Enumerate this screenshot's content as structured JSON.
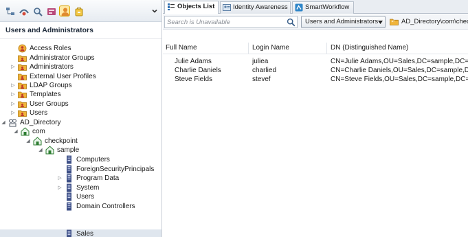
{
  "toolbar": {
    "buttons": [
      {
        "icon": "network-objects-icon"
      },
      {
        "icon": "services-icon"
      },
      {
        "icon": "custom-application-icon"
      },
      {
        "icon": "vpn-communities-icon"
      },
      {
        "icon": "users-icon",
        "active": true
      },
      {
        "icon": "servers-icon"
      }
    ],
    "menu_icon": "chevron-down-icon"
  },
  "panel": {
    "title": "Users and Administrators"
  },
  "tree": [
    {
      "label": "Access Roles",
      "icon": "role-icon",
      "expander": ""
    },
    {
      "label": "Administrator Groups",
      "icon": "group-icon",
      "expander": ""
    },
    {
      "label": "Administrators",
      "icon": "group-icon",
      "expander": "▷"
    },
    {
      "label": "External User Profiles",
      "icon": "group-icon",
      "expander": ""
    },
    {
      "label": "LDAP Groups",
      "icon": "group-icon",
      "expander": "▷"
    },
    {
      "label": "Templates",
      "icon": "group-icon",
      "expander": "▷"
    },
    {
      "label": "User Groups",
      "icon": "group-icon",
      "expander": "▷"
    },
    {
      "label": "Users",
      "icon": "group-icon",
      "expander": "▷"
    },
    {
      "label": "AD_Directory",
      "icon": "directory-icon",
      "expander": "◢"
    },
    {
      "label": "com",
      "icon": "domain-icon",
      "expander": "◢"
    },
    {
      "label": "checkpoint",
      "icon": "domain-icon",
      "expander": "◢"
    },
    {
      "label": "sample",
      "icon": "domain-icon",
      "expander": "◢"
    },
    {
      "label": "Computers",
      "icon": "container-icon",
      "expander": ""
    },
    {
      "label": "ForeignSecurityPrincipals",
      "icon": "container-icon",
      "expander": ""
    },
    {
      "label": "Program Data",
      "icon": "container-icon",
      "expander": "▷"
    },
    {
      "label": "System",
      "icon": "container-icon",
      "expander": "▷"
    },
    {
      "label": "Users",
      "icon": "container-icon",
      "expander": ""
    },
    {
      "label": "Domain Controllers",
      "icon": "container-icon",
      "expander": ""
    },
    {
      "label": "Sales",
      "icon": "container-icon",
      "expander": "",
      "selected": true
    }
  ],
  "tabs": [
    {
      "label": "Objects List",
      "icon": "objects-list-icon",
      "active": true
    },
    {
      "label": "Identity Awareness",
      "icon": "identity-awareness-icon",
      "active": false
    },
    {
      "label": "SmartWorkflow",
      "icon": "smartworkflow-icon",
      "active": false
    }
  ],
  "search": {
    "placeholder": "Search is Unavailable",
    "value": ""
  },
  "scope": {
    "selected": "Users and Administrators"
  },
  "path": {
    "label": "AD_Directory\\com\\checkpoint\\sample\\Sales",
    "icon": "folder-icon"
  },
  "table": {
    "columns": [
      "Full Name",
      "Login Name",
      "DN (Distinguished Name)"
    ],
    "rows": [
      [
        "Julie Adams",
        "juliea",
        "CN=Julie Adams,OU=Sales,DC=sample,DC=checkpoint,DC=com"
      ],
      [
        "Charlie Daniels",
        "charlied",
        "CN=Charlie Daniels,OU=Sales,DC=sample,DC=checkpoint,DC=com"
      ],
      [
        "Steve Fields",
        "stevef",
        "CN=Steve Fields,OU=Sales,DC=sample,DC=checkpoint,DC=com"
      ]
    ]
  },
  "colors": {
    "selection": "#dfe6ee",
    "toolbar_active": "#ffe9a6",
    "folder": "#e9a62a"
  }
}
